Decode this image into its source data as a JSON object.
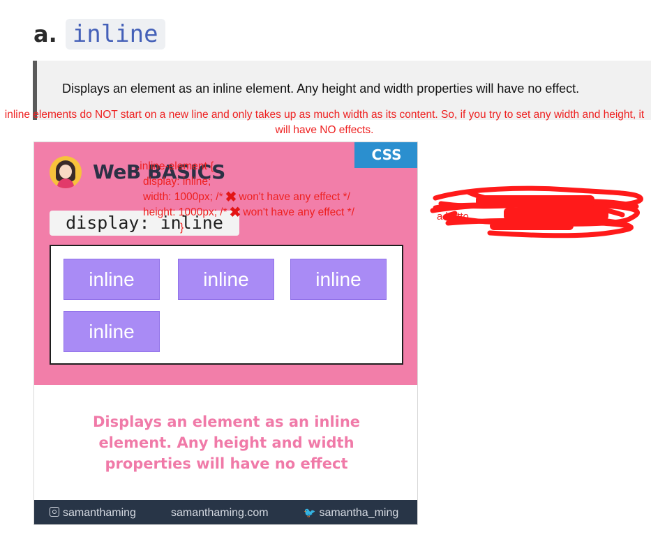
{
  "heading": {
    "prefix": "a.",
    "code": "inline"
  },
  "definition": "Displays an element as an inline element. Any height and width properties will have no effect.",
  "note": "inline elements do NOT start on a new line and only takes up as much width as its content. So, if you try to set any width and height, it will have NO effects.",
  "card": {
    "tag": "CSS",
    "brand": "WeB BASICS",
    "code": "display: inline",
    "blocks": [
      "inline",
      "inline",
      "inline",
      "inline"
    ],
    "description": "Displays an element as an inline element. Any height and width properties will have no effect",
    "footer": {
      "instagram": "samanthaming",
      "website": "samanthaming.com",
      "twitter": "samantha_ming"
    },
    "colors": {
      "pink": "#f27ea9",
      "purple": "#a98bf5",
      "blue": "#2b8fcf",
      "footer": "#283547"
    }
  },
  "code_note": {
    "line1": ".inline-element {",
    "line2": "display: inline;",
    "line3a": "width: 1000px; /*",
    "line3b": "won't have any effect */",
    "line4a": "height: 1000px; /*",
    "line4b": "won't have any effect */",
    "line5": "}"
  },
  "redacted_fragment": "a botto",
  "icons": [
    "cross-mark-icon",
    "instagram-icon",
    "twitter-bird-icon",
    "avatar-icon"
  ]
}
